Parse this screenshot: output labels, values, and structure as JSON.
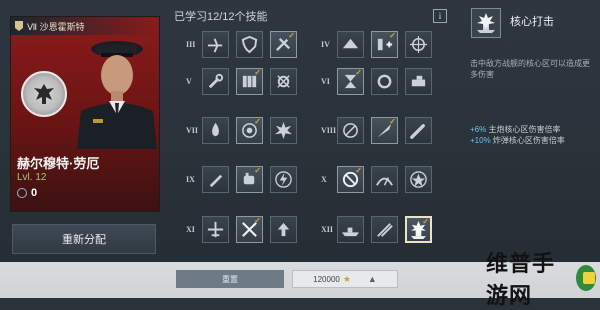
{
  "captain": {
    "tier_label": "Ⅶ 沙恩霍斯特",
    "name": "赫尔穆特·劳厄",
    "level": "Lvl. 12",
    "points": "0",
    "reset_button": "重新分配"
  },
  "skills": {
    "header": "已学习12/12个技能",
    "info_button": "i",
    "tiers": [
      "III",
      "IV",
      "V",
      "VI",
      "VII",
      "VIII",
      "IX",
      "X",
      "XI",
      "XII"
    ],
    "icons": [
      [
        "plane-icon",
        "shield-icon",
        "tools-icon",
        "ship-bow-icon",
        "ammo-plus-icon",
        "crosshair-icon"
      ],
      [
        "wrench-icon",
        "shells-icon",
        "gear-cross-icon",
        "hourglass-icon",
        "ring-icon",
        "tank-icon"
      ],
      [
        "flame-icon",
        "target-icon",
        "explosion-icon",
        "fire-off-icon",
        "rocket-check-icon",
        "torpedo-icon"
      ],
      [
        "pen-icon",
        "fist-icon",
        "bolt-icon",
        "no-entry-icon",
        "radar-icon",
        "star-icon"
      ],
      [
        "fighter-icon",
        "swords-icon",
        "arrow-up-icon",
        "ship-side-icon",
        "twin-guns-icon",
        "citadel-icon"
      ]
    ],
    "learned": [
      [
        false,
        false,
        true,
        false,
        true,
        false
      ],
      [
        false,
        true,
        false,
        true,
        false,
        false
      ],
      [
        false,
        true,
        false,
        false,
        true,
        false
      ],
      [
        false,
        true,
        false,
        true,
        false,
        false
      ],
      [
        false,
        true,
        false,
        false,
        false,
        true
      ]
    ],
    "selected": "citadel-icon"
  },
  "detail": {
    "title": "核心打击",
    "description": "击中敌方战舰的核心区可以造成更多伤害",
    "bonuses": [
      {
        "value": "+6%",
        "text": " 主炮核心区伤害倍率"
      },
      {
        "value": "+10%",
        "text": " 炸弹核心区伤害倍率"
      }
    ]
  },
  "bottom": {
    "reset_label": "重置",
    "cost": "120000"
  },
  "watermark": {
    "text": "维普手游网"
  },
  "colors": {
    "captain_bg": "#8c1b1b",
    "level_green": "#9fd05a",
    "check_gold": "#d4a53a",
    "bonus_blue": "#6ec3ee"
  }
}
